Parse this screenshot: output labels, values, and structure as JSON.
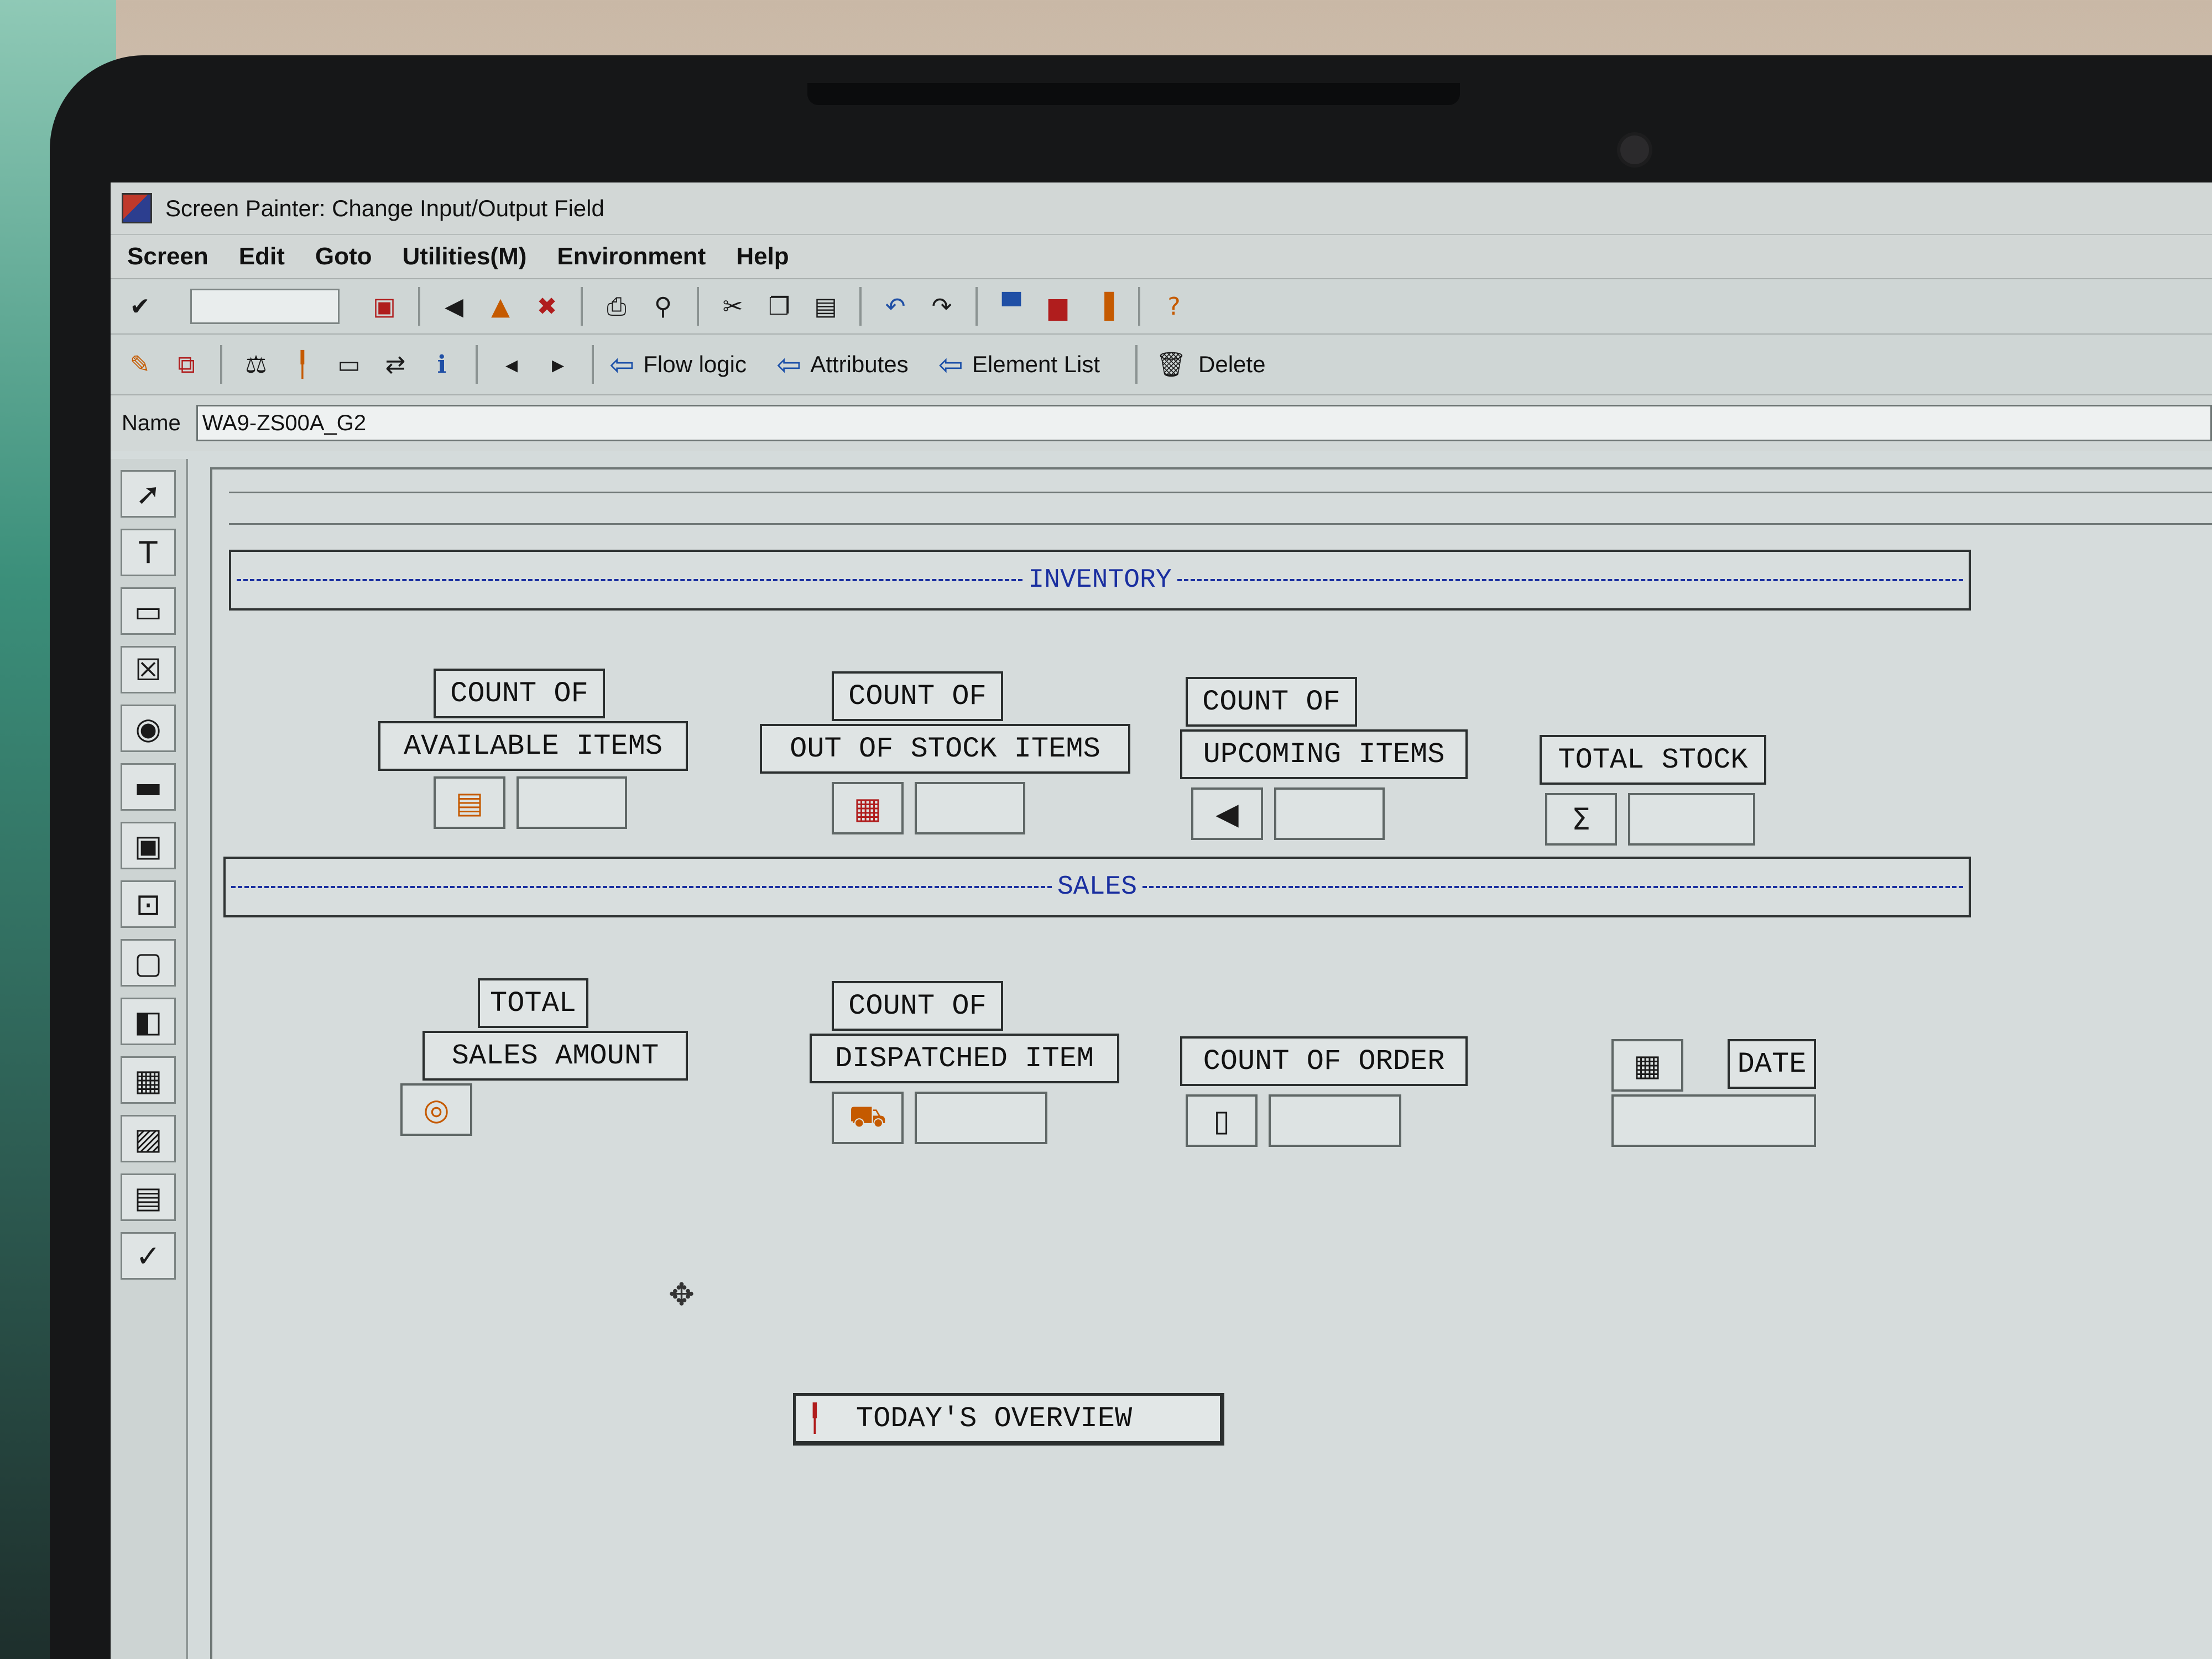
{
  "window": {
    "title": "Screen Painter: Change Input/Output Field"
  },
  "menu": [
    "Screen",
    "Edit",
    "Goto",
    "Utilities(M)",
    "Environment",
    "Help"
  ],
  "toolbar1": {
    "icons": [
      "enter-icon",
      "save-icon",
      "back-icon",
      "exit-icon",
      "cancel-icon",
      "print-icon",
      "find-icon",
      "cut-icon",
      "copy-icon",
      "paste-icon",
      "undo-icon",
      "redo-icon",
      "window-icon",
      "window-red-icon",
      "window-yellow-icon",
      "help-icon"
    ]
  },
  "toolbar2": {
    "flow_logic": "Flow logic",
    "attributes": "Attributes",
    "element_list": "Element List",
    "delete": "Delete"
  },
  "name_row": {
    "label": "Name",
    "value": "WA9-ZS00A_G2"
  },
  "canvas": {
    "inventory_title": "INVENTORY",
    "sales_title": "SALES",
    "inventory": [
      {
        "line1": "COUNT OF",
        "line2": "AVAILABLE ITEMS",
        "icon": "archive-icon"
      },
      {
        "line1": "COUNT OF",
        "line2": "OUT OF STOCK ITEMS",
        "icon": "grid-icon"
      },
      {
        "line1": "COUNT OF",
        "line2": "UPCOMING ITEMS",
        "icon": "speaker-icon"
      },
      {
        "line1": "",
        "line2": "TOTAL STOCK",
        "icon": "sigma-icon"
      }
    ],
    "sales": [
      {
        "line1": "TOTAL",
        "line2": "SALES AMOUNT",
        "icon": "coin-icon"
      },
      {
        "line1": "COUNT OF",
        "line2": "DISPATCHED ITEM",
        "icon": "truck-icon"
      },
      {
        "line1": "",
        "line2": "COUNT OF ORDER",
        "icon": "document-icon"
      },
      {
        "line1": "",
        "line2": "DATE",
        "icon": "calendar-icon"
      }
    ],
    "overview_button": "TODAY'S OVERVIEW"
  }
}
